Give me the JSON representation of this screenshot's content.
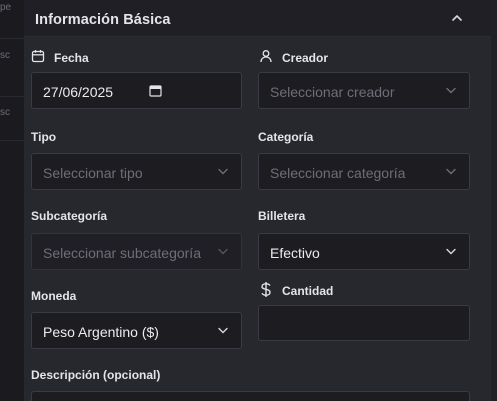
{
  "background": {
    "fragments": [
      "pe",
      "sc",
      "sc"
    ]
  },
  "section": {
    "title": "Información Básica",
    "collapse_icon": "chevron-up-icon"
  },
  "form": {
    "fecha": {
      "label": "Fecha",
      "icon": "calendar-icon",
      "value": "27/06/2025"
    },
    "creador": {
      "label": "Creador",
      "icon": "user-icon",
      "placeholder": "Seleccionar creador"
    },
    "tipo": {
      "label": "Tipo",
      "placeholder": "Seleccionar tipo"
    },
    "categoria": {
      "label": "Categoría",
      "placeholder": "Seleccionar categoría"
    },
    "subcategoria": {
      "label": "Subcategoría",
      "placeholder": "Seleccionar subcategoría"
    },
    "billetera": {
      "label": "Billetera",
      "value": "Efectivo"
    },
    "moneda": {
      "label": "Moneda",
      "value": "Peso Argentino ($)"
    },
    "cantidad": {
      "label": "Cantidad",
      "icon": "dollar-icon",
      "value": ""
    },
    "descripcion": {
      "label": "Descripción (opcional)"
    }
  },
  "colors": {
    "panel": "#27272e",
    "input": "#1c1c21",
    "border": "#3a3a42",
    "text": "#e4e4e9",
    "placeholder": "#6e6e77"
  }
}
